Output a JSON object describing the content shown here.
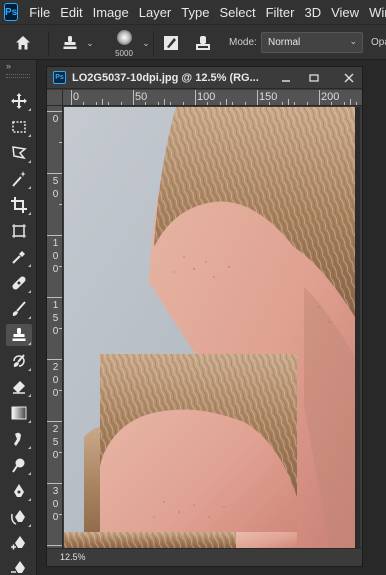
{
  "app": {
    "logo_text": "Ps",
    "menu": [
      "File",
      "Edit",
      "Image",
      "Layer",
      "Type",
      "Select",
      "Filter",
      "3D",
      "View",
      "Wind"
    ]
  },
  "options": {
    "brush_size": "5000",
    "mode_label": "Mode:",
    "mode_value": "Normal",
    "opacity_label": "Opa"
  },
  "toolbar": {
    "collapse_glyph": "»",
    "active_tool": "clone-stamp"
  },
  "document": {
    "icon_text": "Ps",
    "title": "LO2G5037-10dpi.jpg @ 12.5% (RG...",
    "zoom": "12.5%",
    "ruler_h": [
      "0",
      "50",
      "100",
      "150",
      "200"
    ],
    "ruler_v": [
      "0",
      "50",
      "100",
      "150",
      "200",
      "250",
      "300"
    ]
  },
  "colors": {
    "ui_dark": "#323232",
    "accent_blue": "#31a8ff",
    "canvas_bg": "#282828"
  }
}
